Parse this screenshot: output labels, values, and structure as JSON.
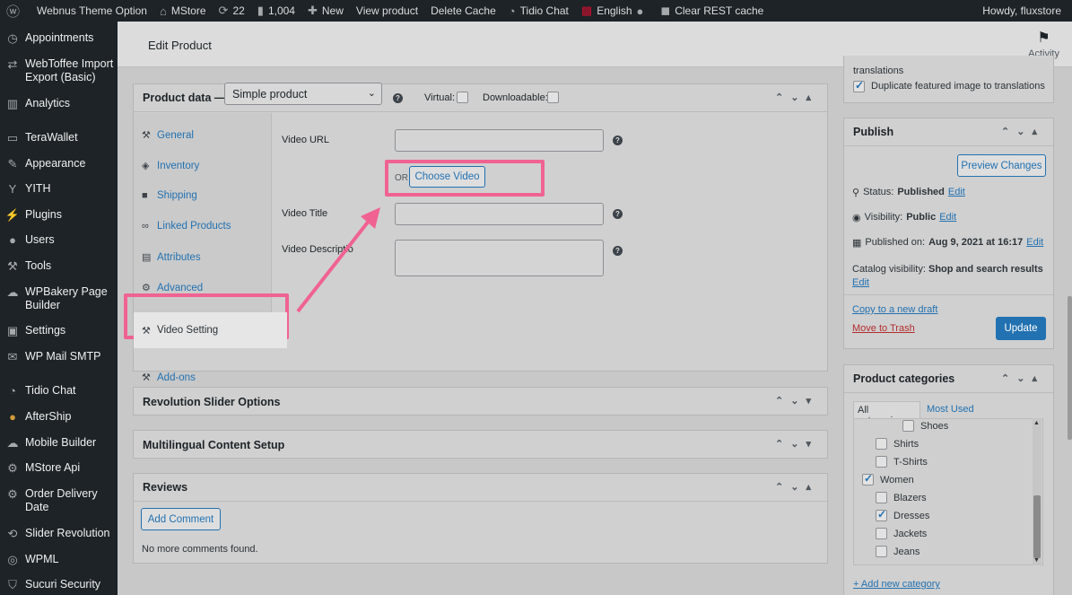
{
  "admin_bar": {
    "site_option": "Webnus Theme Option",
    "site_name": "MStore",
    "updates": "22",
    "comments": "1,004",
    "new": "New",
    "view_product": "View product",
    "delete_cache": "Delete Cache",
    "tidio": "Tidio Chat",
    "language": "English",
    "clear_cache": "Clear REST cache",
    "howdy": "Howdy, fluxstore"
  },
  "sidebar": {
    "items": [
      {
        "label": "Appointments",
        "icon": "clock-icon"
      },
      {
        "label": "WebToffee Import Export (Basic)",
        "icon": "import-icon"
      },
      {
        "label": "Analytics",
        "icon": "bar-chart-icon"
      },
      {
        "label": "TeraWallet",
        "icon": "wallet-icon"
      },
      {
        "label": "Appearance",
        "icon": "brush-icon"
      },
      {
        "label": "YITH",
        "icon": "yith-icon"
      },
      {
        "label": "Plugins",
        "icon": "plug-icon"
      },
      {
        "label": "Users",
        "icon": "user-icon"
      },
      {
        "label": "Tools",
        "icon": "wrench-icon"
      },
      {
        "label": "WPBakery Page Builder",
        "icon": "cloud-icon"
      },
      {
        "label": "Settings",
        "icon": "settings-icon"
      },
      {
        "label": "WP Mail SMTP",
        "icon": "mail-icon"
      },
      {
        "label": "Tidio Chat",
        "icon": "chat-icon"
      },
      {
        "label": "AfterShip",
        "icon": "aftership-icon"
      },
      {
        "label": "Mobile Builder",
        "icon": "cloud-icon"
      },
      {
        "label": "MStore Api",
        "icon": "gear-icon"
      },
      {
        "label": "Order Delivery Date",
        "icon": "gear-icon"
      },
      {
        "label": "Slider Revolution",
        "icon": "refresh-icon"
      },
      {
        "label": "WPML",
        "icon": "wpml-icon"
      },
      {
        "label": "Sucuri Security",
        "icon": "shield-icon"
      }
    ]
  },
  "header": {
    "title": "Edit Product",
    "activity": "Activity"
  },
  "product_data": {
    "label": "Product data —",
    "type": "Simple product",
    "virtual": "Virtual:",
    "downloadable": "Downloadable:",
    "tabs": [
      {
        "label": "General",
        "icon": "wrench-icon"
      },
      {
        "label": "Inventory",
        "icon": "tag-icon"
      },
      {
        "label": "Shipping",
        "icon": "truck-icon"
      },
      {
        "label": "Linked Products",
        "icon": "link-icon"
      },
      {
        "label": "Attributes",
        "icon": "list-icon"
      },
      {
        "label": "Advanced",
        "icon": "gear-icon"
      },
      {
        "label": "Video Setting",
        "icon": "wrench-icon"
      },
      {
        "label": "Add-ons",
        "icon": "wrench-icon"
      }
    ],
    "video_url_label": "Video URL",
    "or": "OR",
    "choose_video": "Choose Video",
    "video_title_label": "Video Title",
    "video_description_label": "Video Description"
  },
  "panels": {
    "revolution": "Revolution Slider Options",
    "multilingual": "Multilingual Content Setup",
    "reviews": "Reviews",
    "add_comment": "Add Comment",
    "no_comments": "No more comments found."
  },
  "translations": {
    "partial": "translations",
    "duplicate": "Duplicate featured image to translations"
  },
  "publish": {
    "title": "Publish",
    "preview": "Preview Changes",
    "status_label": "Status:",
    "status_value": "Published",
    "visibility_label": "Visibility:",
    "visibility_value": "Public",
    "published_label": "Published on:",
    "published_value": "Aug 9, 2021 at 16:17",
    "catalog_label": "Catalog visibility:",
    "catalog_value": "Shop and search results",
    "edit": "Edit",
    "copy_draft": "Copy to a new draft",
    "trash": "Move to Trash",
    "update": "Update"
  },
  "categories": {
    "title": "Product categories",
    "tab_all": "All categories",
    "tab_used": "Most Used",
    "items": [
      {
        "label": "Shoes",
        "checked": false
      },
      {
        "label": "Shirts",
        "checked": false
      },
      {
        "label": "T-Shirts",
        "checked": false
      },
      {
        "label": "Women",
        "checked": true
      },
      {
        "label": "Blazers",
        "checked": false
      },
      {
        "label": "Dresses",
        "checked": true
      },
      {
        "label": "Jackets",
        "checked": false
      },
      {
        "label": "Jeans",
        "checked": false
      }
    ],
    "add_new": "+ Add new category"
  },
  "colors": {
    "accent": "#2271b1",
    "highlight": "#f06292",
    "sidebar": "#1d2327"
  }
}
